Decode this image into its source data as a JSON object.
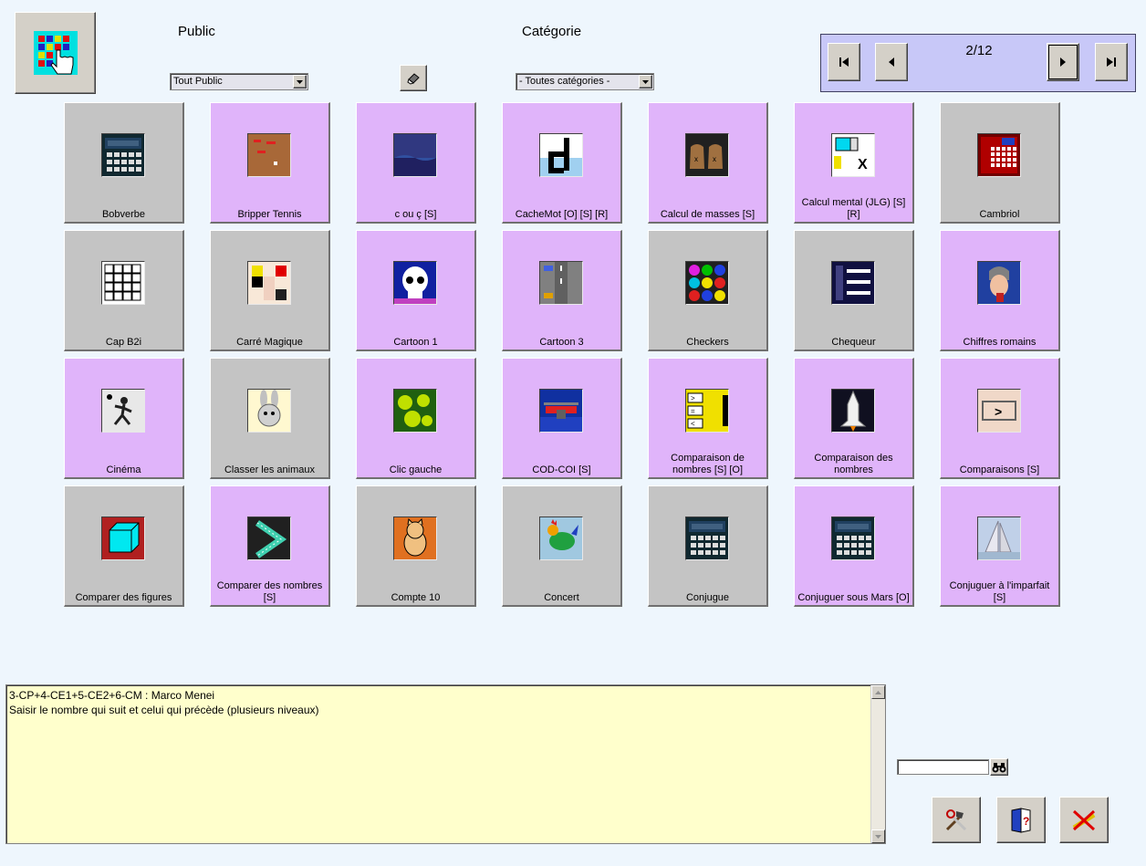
{
  "filters": {
    "public_label": "Public",
    "public_value": "Tout Public",
    "category_label": "Catégorie",
    "category_value": "- Toutes catégories -"
  },
  "pagination": {
    "page": "2/12"
  },
  "tiles": [
    {
      "name": "Bobverbe",
      "color": "gray",
      "icon": "calculator-icon"
    },
    {
      "name": "Bripper Tennis",
      "color": "pink",
      "icon": "board-game-icon"
    },
    {
      "name": "c ou ç [S]",
      "color": "pink",
      "icon": "night-sea-icon"
    },
    {
      "name": "CacheMot [O] [S] [R]",
      "color": "pink",
      "icon": "letter-d-icon"
    },
    {
      "name": "Calcul de masses [S]",
      "color": "pink",
      "icon": "weight-bags-icon"
    },
    {
      "name": "Calcul mental (JLG) [S] [R]",
      "color": "pink",
      "icon": "spinner-x-icon"
    },
    {
      "name": "Cambriol",
      "color": "gray",
      "icon": "safe-icon"
    },
    {
      "name": "Cap B2i",
      "color": "gray",
      "icon": "keyboard-icon"
    },
    {
      "name": "Carré Magique",
      "color": "gray",
      "icon": "magic-square-icon"
    },
    {
      "name": "Cartoon 1",
      "color": "pink",
      "icon": "skull-icon"
    },
    {
      "name": "Cartoon 3",
      "color": "pink",
      "icon": "road-cars-icon"
    },
    {
      "name": "Checkers",
      "color": "gray",
      "icon": "color-dots-icon"
    },
    {
      "name": "Chequeur",
      "color": "gray",
      "icon": "cheque-icon"
    },
    {
      "name": "Chiffres romains",
      "color": "pink",
      "icon": "roman-soldier-icon"
    },
    {
      "name": "Cinéma",
      "color": "pink",
      "icon": "running-man-icon"
    },
    {
      "name": "Classer les animaux",
      "color": "gray",
      "icon": "rabbit-icon"
    },
    {
      "name": "Clic gauche",
      "color": "pink",
      "icon": "flowers-icon"
    },
    {
      "name": "COD-COI [S]",
      "color": "pink",
      "icon": "airplane-icon"
    },
    {
      "name": "Comparaison de nombres [S] [O]",
      "color": "pink",
      "icon": "compare-signs-icon"
    },
    {
      "name": "Comparaison des nombres",
      "color": "pink",
      "icon": "space-shuttle-icon"
    },
    {
      "name": "Comparaisons [S]",
      "color": "pink",
      "icon": "greater-than-icon"
    },
    {
      "name": "Comparer des figures",
      "color": "gray",
      "icon": "cube-icon"
    },
    {
      "name": "Comparer des nombres [S]",
      "color": "pink",
      "icon": "chevron-shape-icon"
    },
    {
      "name": "Compte 10",
      "color": "gray",
      "icon": "cat-icon"
    },
    {
      "name": "Concert",
      "color": "gray",
      "icon": "rooster-icon"
    },
    {
      "name": "Conjugue",
      "color": "gray",
      "icon": "calculator-icon"
    },
    {
      "name": "Conjuguer sous Mars [O]",
      "color": "pink",
      "icon": "calculator-icon"
    },
    {
      "name": "Conjuguer à  l'imparfait [S]",
      "color": "pink",
      "icon": "sailboat-icon"
    }
  ],
  "description": {
    "line1": "3-CP+4-CE1+5-CE2+6-CM : Marco Menei",
    "line2": "Saisir le nombre qui suit et celui qui précède (plusieurs niveaux)"
  },
  "search": {
    "value": ""
  }
}
